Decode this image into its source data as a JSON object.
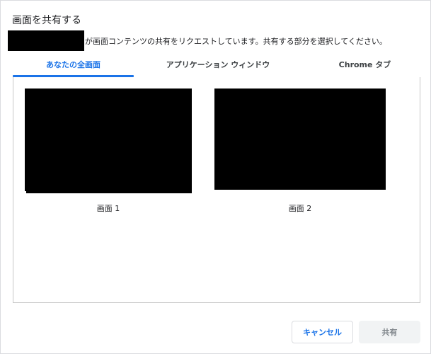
{
  "dialog": {
    "title": "画面を共有する",
    "message": "が画面コンテンツの共有をリクエストしています。共有する部分を選択してください。"
  },
  "tabs": [
    {
      "label": "あなたの全画面",
      "active": true
    },
    {
      "label": "アプリケーション ウィンドウ",
      "active": false
    },
    {
      "label": "Chrome タブ",
      "active": false
    }
  ],
  "screens": [
    {
      "label": "画面 1"
    },
    {
      "label": "画面 2"
    }
  ],
  "buttons": {
    "cancel": "キャンセル",
    "share": "共有"
  },
  "colors": {
    "accent": "#1a73e8",
    "disabled_bg": "#f1f3f4",
    "disabled_text": "#80868b"
  }
}
